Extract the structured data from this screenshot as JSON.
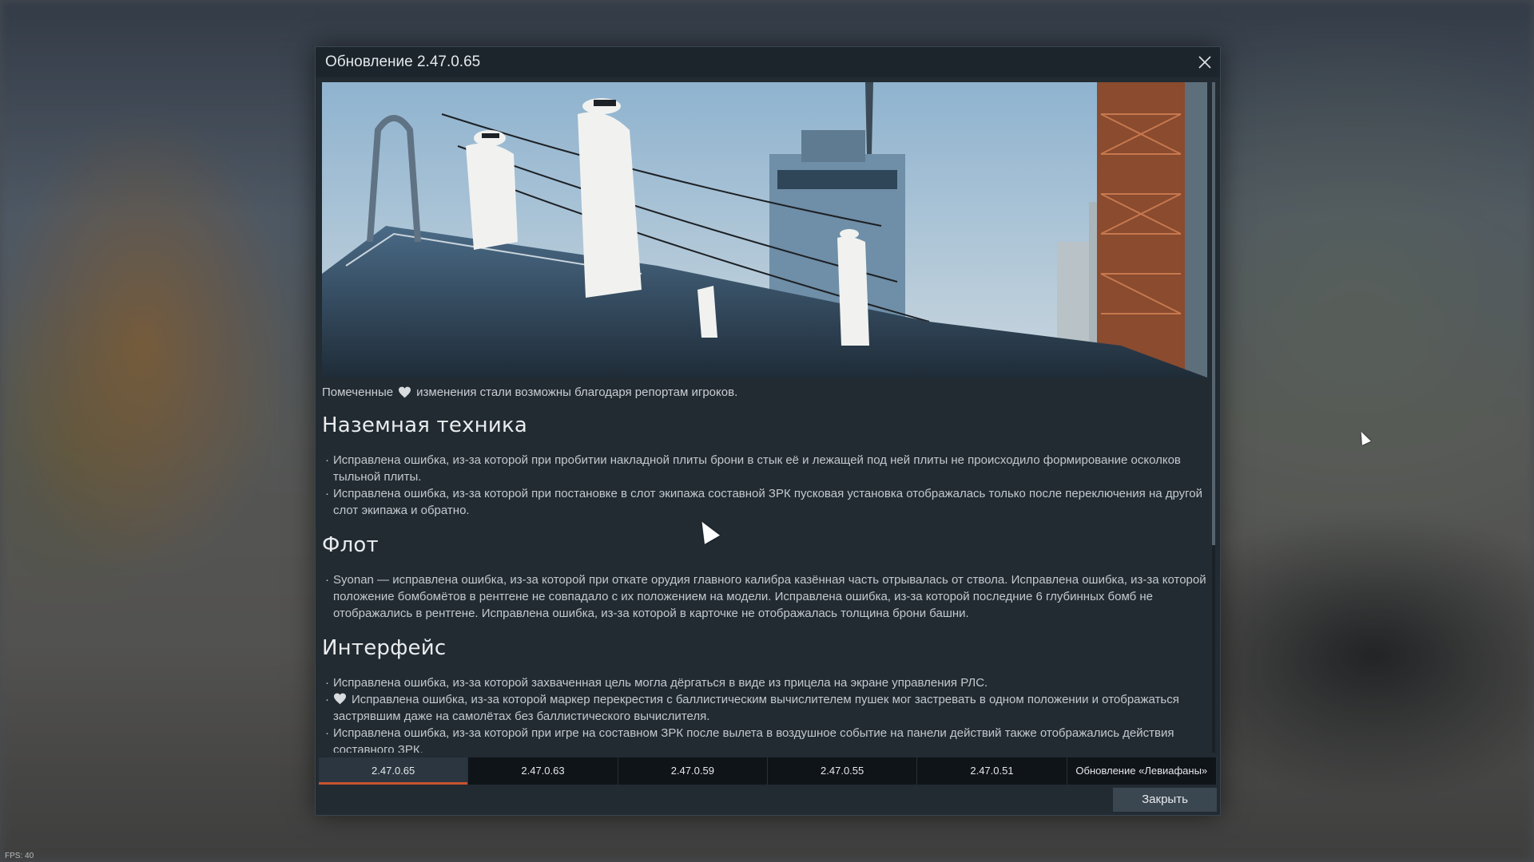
{
  "window": {
    "title": "Обновление 2.47.0.65"
  },
  "intro_note": {
    "prefix": "Помеченные",
    "icon": "heart-icon",
    "suffix": "изменения стали возможны благодаря репортам игроков."
  },
  "sections": [
    {
      "heading": "Наземная техника",
      "items": [
        {
          "text": "Исправлена ошибка, из-за которой при пробитии накладной плиты брони в стык её и лежащей под ней плиты не происходило формирование осколков тыльной плиты."
        },
        {
          "text": "Исправлена ошибка, из-за которой при постановке в слот экипажа составной ЗРК пусковая установка отображалась только после переключения на другой слот экипажа и обратно."
        }
      ]
    },
    {
      "heading": "Флот",
      "items": [
        {
          "text": "Syonan — исправлена ошибка, из-за которой при откате орудия главного калибра казённая часть отрывалась от ствола. Исправлена ошибка, из-за которой положение бомбомётов в рентгене не совпадало с их положением на модели. Исправлена ошибка, из-за которой последние 6 глубинных бомб не отображались в рентгене. Исправлена ошибка, из-за которой в карточке не отображалась толщина брони башни."
        }
      ]
    },
    {
      "heading": "Интерфейс",
      "items": [
        {
          "text": "Исправлена ошибка, из-за которой захваченная цель могла дёргаться в виде из прицела на экране управления РЛС."
        },
        {
          "text": "Исправлена ошибка, из-за которой маркер перекрестия с баллистическим вычислителем пушек мог застревать в одном положении и отображаться застрявшим даже на самолётах без баллистического вычислителя.",
          "marked": true
        },
        {
          "text": "Исправлена ошибка, из-за которой при игре на составном ЗРК после вылета в воздушное событие на панели действий также отображались действия составного ЗРК."
        }
      ]
    }
  ],
  "tabs": [
    {
      "label": "2.47.0.65",
      "active": true
    },
    {
      "label": "2.47.0.63"
    },
    {
      "label": "2.47.0.59"
    },
    {
      "label": "2.47.0.55"
    },
    {
      "label": "2.47.0.51"
    },
    {
      "label": "Обновление «Левиафаны»"
    }
  ],
  "footer": {
    "close_label": "Закрыть"
  },
  "status": {
    "fps": "FPS: 40"
  },
  "colors": {
    "accent": "#c8532f",
    "dialog_bg": "#222b32",
    "tab_bg": "#0f1418"
  }
}
